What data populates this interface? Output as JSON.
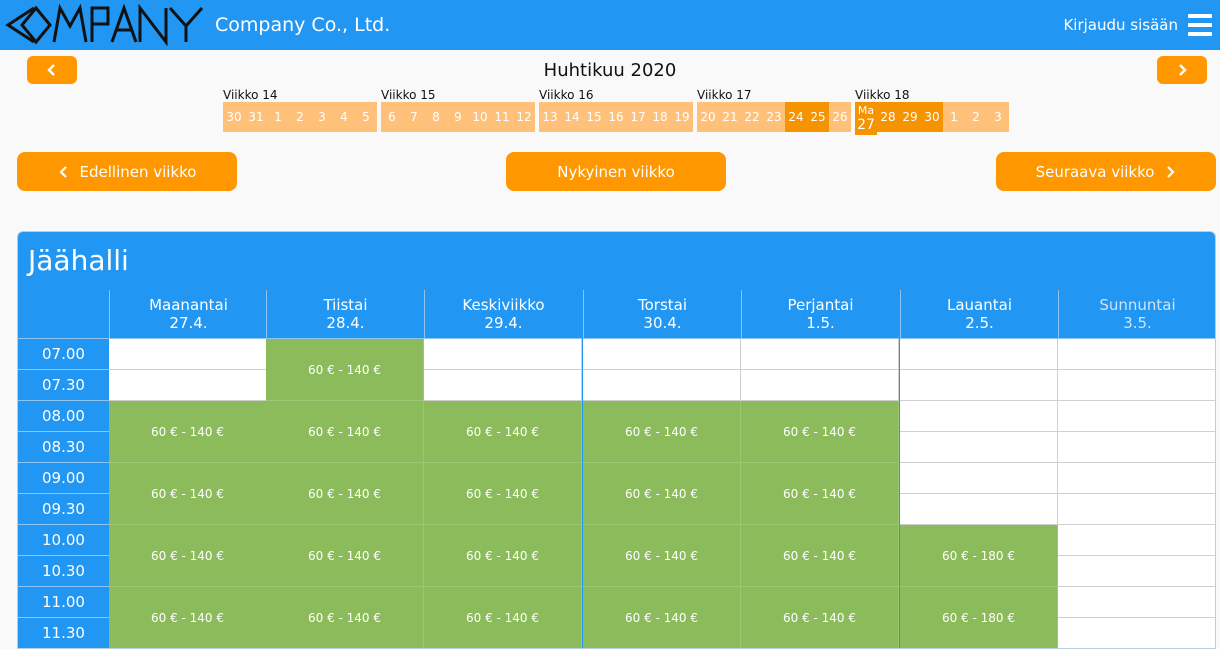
{
  "header": {
    "logo_text": "COMPANY",
    "brand": "Company Co., Ltd.",
    "login": "Kirjaudu sisään"
  },
  "calendar": {
    "month_title": "Huhtikuu 2020",
    "weeks": [
      {
        "label": "Viikko 14",
        "days": [
          "30",
          "31",
          "1",
          "2",
          "3",
          "4",
          "5"
        ]
      },
      {
        "label": "Viikko 15",
        "days": [
          "6",
          "7",
          "8",
          "9",
          "10",
          "11",
          "12"
        ]
      },
      {
        "label": "Viikko 16",
        "days": [
          "13",
          "14",
          "15",
          "16",
          "17",
          "18",
          "19"
        ]
      },
      {
        "label": "Viikko 17",
        "days": [
          "20",
          "21",
          "22",
          "23",
          "24",
          "25",
          "26"
        ]
      },
      {
        "label": "Viikko 18",
        "days": [
          "27",
          "28",
          "29",
          "30",
          "1",
          "2",
          "3"
        ]
      }
    ],
    "today_weekday": "Ma",
    "today_day": "27"
  },
  "nav": {
    "prev": "Edellinen viikko",
    "current": "Nykyinen viikko",
    "next": "Seuraava viikko"
  },
  "schedule": {
    "title": "Jäähalli",
    "columns": [
      {
        "day": "Maanantai",
        "date": "27.4."
      },
      {
        "day": "Tiistai",
        "date": "28.4."
      },
      {
        "day": "Keskiviikko",
        "date": "29.4."
      },
      {
        "day": "Torstai",
        "date": "30.4."
      },
      {
        "day": "Perjantai",
        "date": "1.5."
      },
      {
        "day": "Lauantai",
        "date": "2.5."
      },
      {
        "day": "Sunnuntai",
        "date": "3.5."
      }
    ],
    "times": [
      "07.00",
      "07.30",
      "08.00",
      "08.30",
      "09.00",
      "09.30",
      "10.00",
      "10.30",
      "11.00",
      "11.30"
    ],
    "price_weekday": "60 € - 140 €",
    "price_saturday": "60 € - 180 €"
  },
  "colors": {
    "primary": "#2196f3",
    "accent": "#ff9800",
    "available": "#8bbb5b",
    "day_light": "#ffc07a",
    "day_dark": "#f59300"
  }
}
